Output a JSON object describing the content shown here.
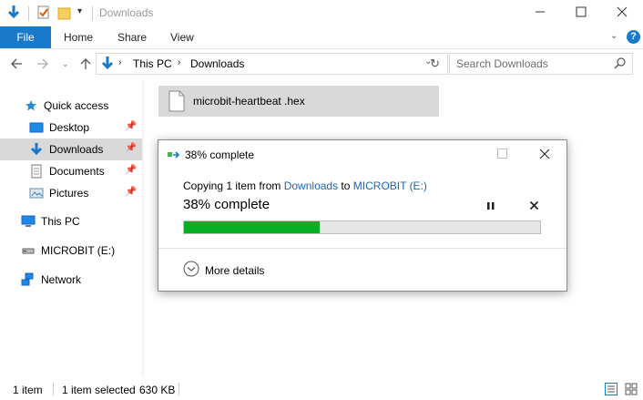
{
  "window": {
    "title": "Downloads",
    "minimize_icon": "minimize-icon",
    "maximize_icon": "maximize-icon",
    "close_icon": "close-icon"
  },
  "ribbon": {
    "tabs": [
      "File",
      "Home",
      "Share",
      "View"
    ]
  },
  "address": {
    "path": [
      "This PC",
      "Downloads"
    ],
    "search_placeholder": "Search Downloads"
  },
  "sidebar": {
    "quick_access": "Quick access",
    "items": [
      "Desktop",
      "Downloads",
      "Documents",
      "Pictures"
    ],
    "this_pc": "This PC",
    "drive": "MICROBIT (E:)",
    "network": "Network"
  },
  "files": [
    {
      "name": "microbit-heartbeat .hex"
    }
  ],
  "status": {
    "count": "1 item",
    "selected": "1 item selected",
    "size": "630 KB"
  },
  "dialog": {
    "title": "38% complete",
    "copy_prefix": "Copying 1 item from ",
    "source": "Downloads",
    "to_word": " to ",
    "destination": "MICROBIT (E:)",
    "progress_text": "38% complete",
    "progress_fraction": 0.38,
    "more_details": "More details",
    "pause_icon": "pause-icon",
    "cancel_icon": "close-icon"
  },
  "colors": {
    "accent": "#1979ca",
    "progress": "#06b025",
    "link": "#1a66b3",
    "selection": "#d9d9d9"
  }
}
